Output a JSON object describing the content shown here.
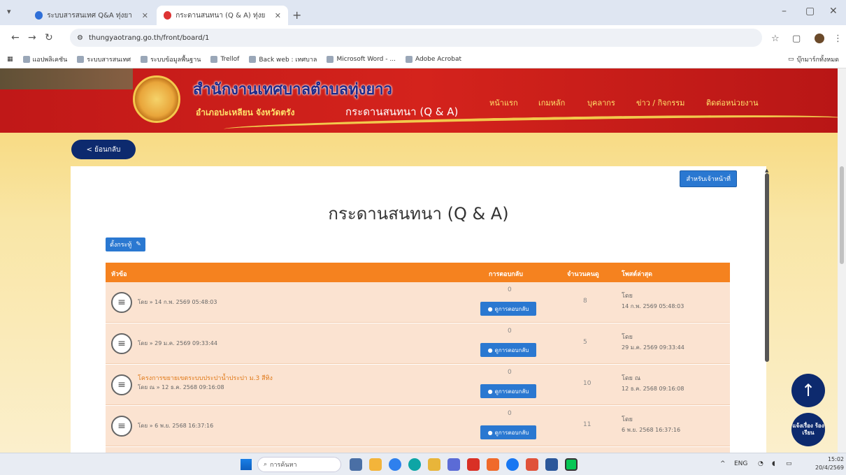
{
  "browser": {
    "tabs": [
      {
        "label": "ระบบสารสนเทศ Q&A ทุ่งยาว",
        "active": false
      },
      {
        "label": "กระดานสนทนา (Q & A) ทุ่งยาว",
        "active": true
      }
    ],
    "new_tab": "+",
    "url": "thungyaotrang.go.th/front/board/1",
    "bookmarks": [
      "แอปพลิเคชัน",
      "ระบบสารสนเทศ",
      "ระบบข้อมูลพื้นฐาน",
      "Trellof",
      "Back web : เทศบาล",
      "Microsoft Word - ...",
      "Adobe Acrobat"
    ],
    "bookmarks_right": "บุ๊กมาร์กทั้งหมด"
  },
  "site": {
    "title": "สำนักงานเทศบาลตำบลทุ่งยาว",
    "subtitle": "อำเภอปะเหลียน จังหวัดตรัง",
    "page_name": "กระดานสนทนา (Q & A)",
    "nav": [
      "หน้าแรก",
      "เกมหลัก",
      "บุคลากร",
      "ข่าว / กิจกรรม",
      "ติดต่อหน่วยงาน"
    ]
  },
  "back_button": "< ย้อนกลับ",
  "board": {
    "staff_button": "สำหรับเจ้าหน้าที่",
    "heading": "กระดานสนทนา (Q & A)",
    "new_topic": "ตั้งกระทู้",
    "columns": {
      "topic": "หัวข้อ",
      "answers": "การตอบกลับ",
      "views": "จำนวนคนดู",
      "latest": "โพสต์ล่าสุด"
    },
    "view_label": "ดูการตอบกลับ",
    "rows": [
      {
        "title": "",
        "meta": "โดย » 14 ก.พ. 2569 05:48:03",
        "answers": "0",
        "views": "8",
        "last_by": "โดย",
        "last_date": "14 ก.พ. 2569 05:48:03"
      },
      {
        "title": "",
        "meta": "โดย » 29 ม.ค. 2569 09:33:44",
        "answers": "0",
        "views": "5",
        "last_by": "โดย",
        "last_date": "29 ม.ค. 2569 09:33:44"
      },
      {
        "title": "โครงการขยายเขตระบบประปาน้ำประปา ม.3 สีทิง",
        "meta": "โดย ณ » 12 ธ.ค. 2568 09:16:08",
        "answers": "0",
        "views": "10",
        "last_by": "โดย ณ",
        "last_date": "12 ธ.ค. 2568 09:16:08"
      },
      {
        "title": "",
        "meta": "โดย » 6 พ.ย. 2568 16:37:16",
        "answers": "0",
        "views": "11",
        "last_by": "โดย",
        "last_date": "6 พ.ย. 2568 16:37:16"
      }
    ]
  },
  "fab": {
    "up": "↑",
    "new": "แจ้งเรื่อง ร้องเรียน"
  },
  "taskbar": {
    "search_placeholder": "การค้นหา",
    "lang": "ENG",
    "time": "15:02",
    "date": "20/4/2569"
  }
}
